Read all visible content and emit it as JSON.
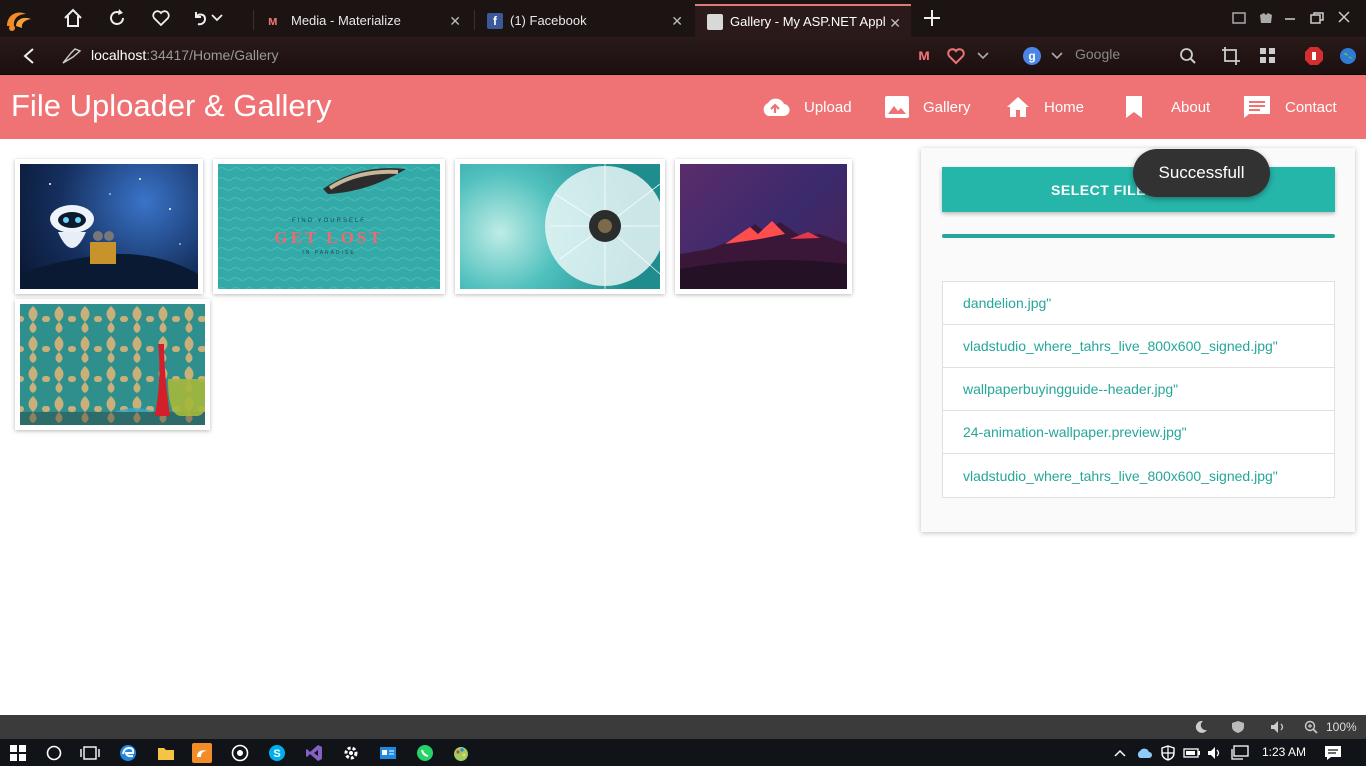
{
  "browser": {
    "tabs": [
      {
        "label": "Media - Materialize",
        "favicon": "materialize-icon"
      },
      {
        "label": "(1) Facebook",
        "favicon": "facebook-icon"
      },
      {
        "label": "Gallery - My ASP.NET Applica",
        "favicon": "page-icon",
        "active": true
      }
    ],
    "address": {
      "host": "localhost",
      "rest": ":34417/Home/Gallery"
    },
    "search_placeholder": "Google",
    "zoom": "100%",
    "accent_color": "#e07a7a"
  },
  "app": {
    "brand": "File Uploader & Gallery",
    "nav": [
      {
        "label": "Upload",
        "icon": "cloud-upload-icon"
      },
      {
        "label": "Gallery",
        "icon": "image-icon"
      },
      {
        "label": "Home",
        "icon": "home-icon"
      },
      {
        "label": "About",
        "icon": "bookmark-icon"
      },
      {
        "label": "Contact",
        "icon": "comment-icon"
      }
    ],
    "navbar_color": "#ef7375"
  },
  "gallery": {
    "images": [
      {
        "name": "wall-e-eve-image",
        "caption": ""
      },
      {
        "name": "get-lost-boat-image",
        "caption": "GET LOST",
        "sub_top": "FIND YOURSELF",
        "sub_bottom": "IN PARADISE"
      },
      {
        "name": "dandelion-image",
        "caption": ""
      },
      {
        "name": "red-mountains-image",
        "caption": ""
      },
      {
        "name": "wallpaper-vases-image",
        "caption": ""
      }
    ]
  },
  "upload_panel": {
    "select_button": "SELECT FILE",
    "progress_percent": 100,
    "files": [
      "dandelion.jpg\"",
      "vladstudio_where_tahrs_live_800x600_signed.jpg\"",
      "wallpaperbuyingguide--header.jpg\"",
      "24-animation-wallpaper.preview.jpg\"",
      "vladstudio_where_tahrs_live_800x600_signed.jpg\""
    ],
    "accent_color": "#26b5a9"
  },
  "toast": {
    "message": "Successfull"
  },
  "taskbar": {
    "clock": "1:23 AM"
  }
}
